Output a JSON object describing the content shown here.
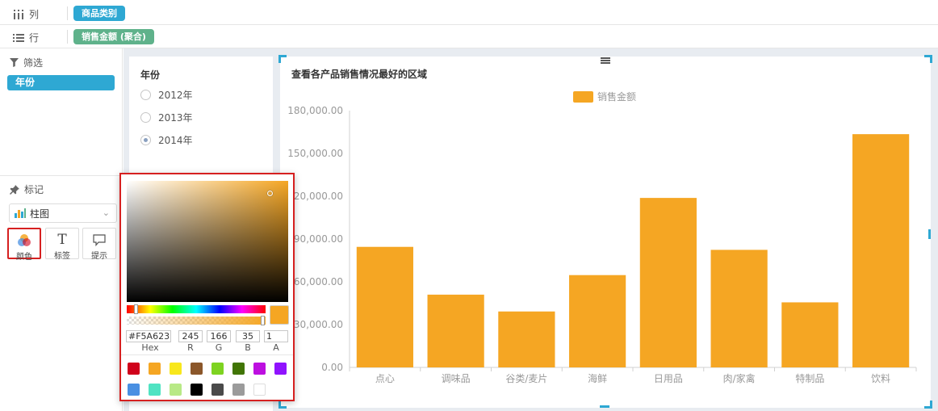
{
  "shelves": {
    "columns": {
      "label": "列",
      "field": "商品类别",
      "icon": "columns-icon"
    },
    "rows": {
      "label": "行",
      "field": "销售金额 (聚合)",
      "icon": "rows-icon"
    }
  },
  "filter": {
    "title": "筛选",
    "icon": "filter-icon",
    "item": "年份"
  },
  "marks": {
    "title": "标记",
    "icon": "pin-icon",
    "chart_type": "柱图",
    "buttons": [
      {
        "label": "颜色",
        "icon": "color-palette-icon"
      },
      {
        "label": "标签",
        "icon": "text-label-icon"
      },
      {
        "label": "提示",
        "icon": "tooltip-icon"
      }
    ]
  },
  "year_filter": {
    "title": "年份",
    "options": [
      {
        "label": "2012年",
        "selected": false
      },
      {
        "label": "2013年",
        "selected": false
      },
      {
        "label": "2014年",
        "selected": true
      }
    ]
  },
  "color_picker": {
    "hex": "#F5A623",
    "r": "245",
    "g": "166",
    "b": "35",
    "a": "1",
    "labels": {
      "hex": "Hex",
      "r": "R",
      "g": "G",
      "b": "B",
      "a": "A"
    },
    "current_color": "#f5a623",
    "swatches": [
      "#d0021b",
      "#f5a623",
      "#f8e71c",
      "#8b572a",
      "#7ed321",
      "#417505",
      "#bd10e0",
      "#9013fe",
      "#4a90e2",
      "#50e3c2",
      "#b8e986",
      "#000000",
      "#4a4a4a",
      "#9b9b9b",
      "#ffffff"
    ]
  },
  "chart_data": {
    "type": "bar",
    "title": "查看各产品销售情况最好的区域",
    "legend": "销售金额",
    "legend_position": "top-center",
    "bar_color": "#f5a623",
    "categories": [
      "点心",
      "调味品",
      "谷类/麦片",
      "海鲜",
      "日用品",
      "肉/家禽",
      "特制品",
      "饮料"
    ],
    "series": [
      {
        "name": "销售金额",
        "values": [
          84500,
          51000,
          39200,
          64700,
          118800,
          82400,
          45600,
          163500
        ]
      }
    ],
    "y_ticks": [
      "0.00",
      "30,000.00",
      "60,000.00",
      "90,000.00",
      "120,000.00",
      "150,000.00",
      "180,000.00"
    ],
    "ylim": [
      0,
      180000
    ],
    "grid": false
  }
}
